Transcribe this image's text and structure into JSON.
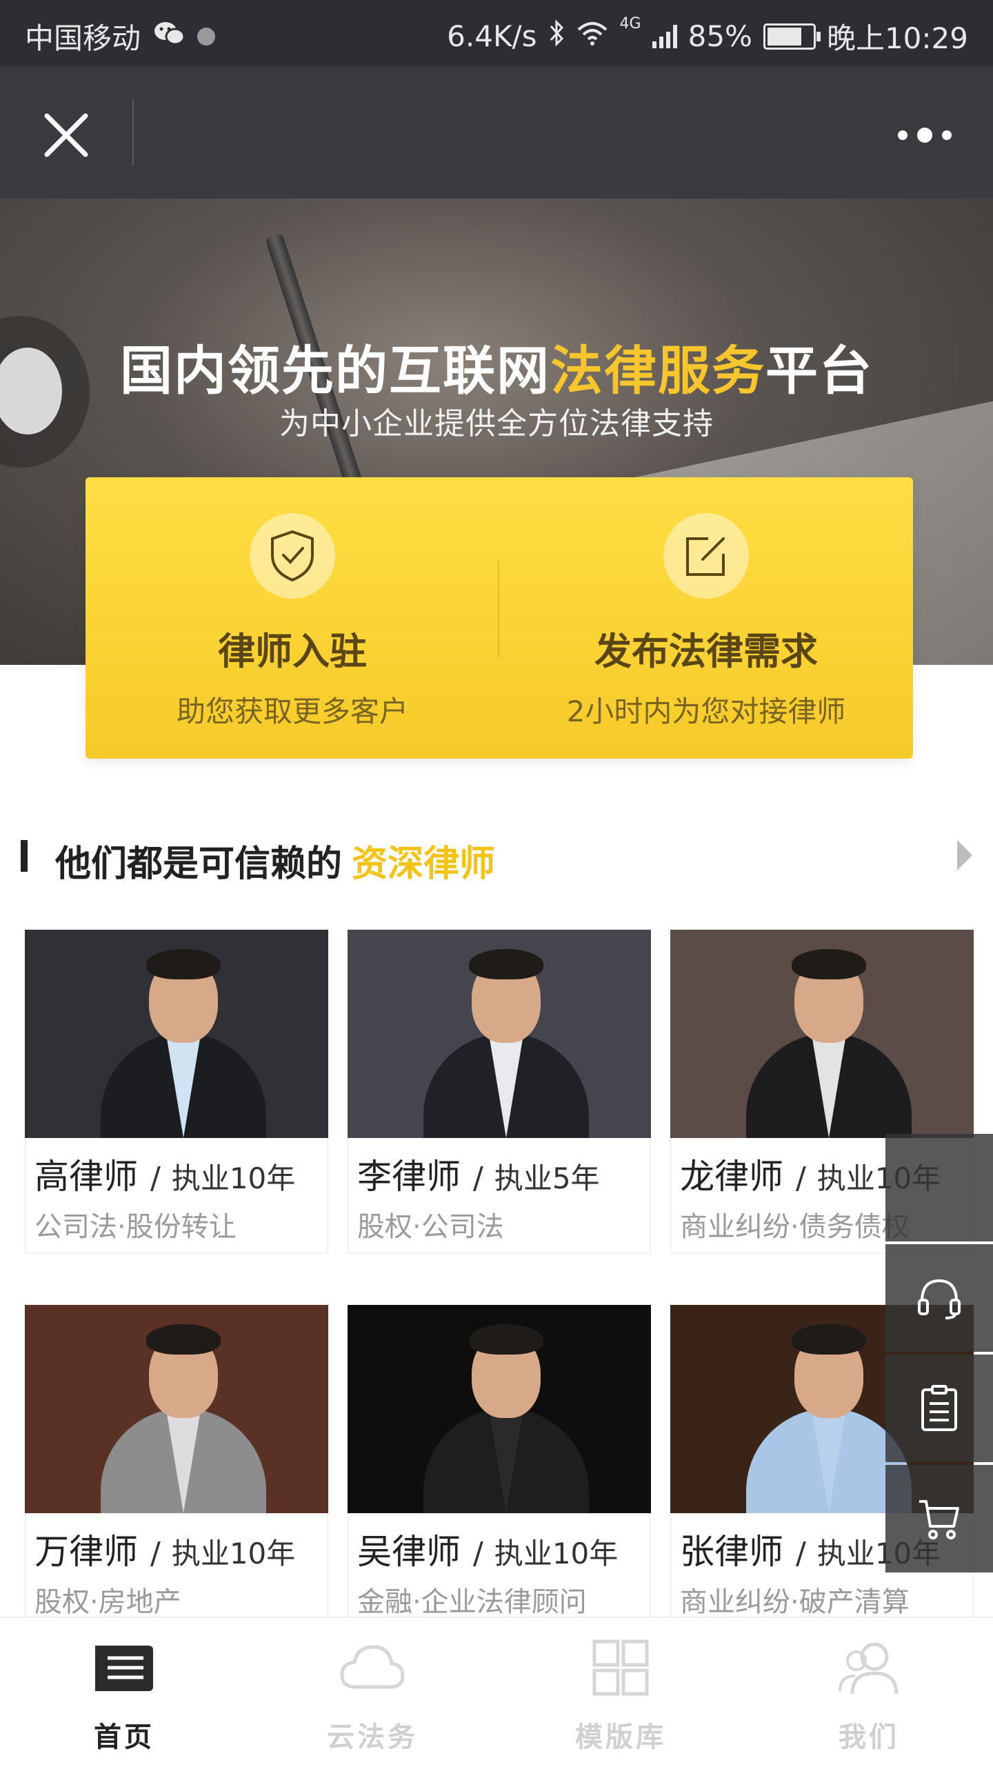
{
  "status_bar": {
    "carrier": "中国移动",
    "speed": "6.4K/s",
    "network": "4G",
    "battery": "85%",
    "battery_level": 0.85,
    "time": "晚上10:29"
  },
  "hero": {
    "title_prefix": "国内领先的互联网",
    "title_highlight": "法律服务",
    "title_suffix": "平台",
    "subtitle": "为中小企业提供全方位法律支持"
  },
  "actions": [
    {
      "title": "律师入驻",
      "subtitle": "助您获取更多客户",
      "icon": "shield-check-icon"
    },
    {
      "title": "发布法律需求",
      "subtitle": "2小时内为您对接律师",
      "icon": "edit-icon"
    }
  ],
  "section": {
    "title": "他们都是可信赖的",
    "highlight": "资深律师"
  },
  "lawyers": [
    {
      "name": "高律师",
      "years": "执业10年",
      "tags": "公司法·股份转让"
    },
    {
      "name": "李律师",
      "years": "执业5年",
      "tags": "股权·公司法"
    },
    {
      "name": "龙律师",
      "years": "执业10年",
      "tags": "商业纠纷·债务债权"
    },
    {
      "name": "万律师",
      "years": "执业10年",
      "tags": "股权·房地产"
    },
    {
      "name": "吴律师",
      "years": "执业10年",
      "tags": "金融·企业法律顾问"
    },
    {
      "name": "张律师",
      "years": "执业10年",
      "tags": "商业纠纷·破产清算"
    }
  ],
  "separator": "/",
  "side_toolbar": [
    "blank",
    "headset-icon",
    "clipboard-icon",
    "cart-icon"
  ],
  "tabs": [
    {
      "label": "首页",
      "icon": "news-icon",
      "active": true
    },
    {
      "label": "云法务",
      "icon": "cloud-icon",
      "active": false
    },
    {
      "label": "模版库",
      "icon": "grid-icon",
      "active": false
    },
    {
      "label": "我们",
      "icon": "users-icon",
      "active": false
    }
  ],
  "colors": {
    "accent": "#f3c318",
    "card_yellow": "#ffde44",
    "titlebar": "#3a3b40"
  }
}
